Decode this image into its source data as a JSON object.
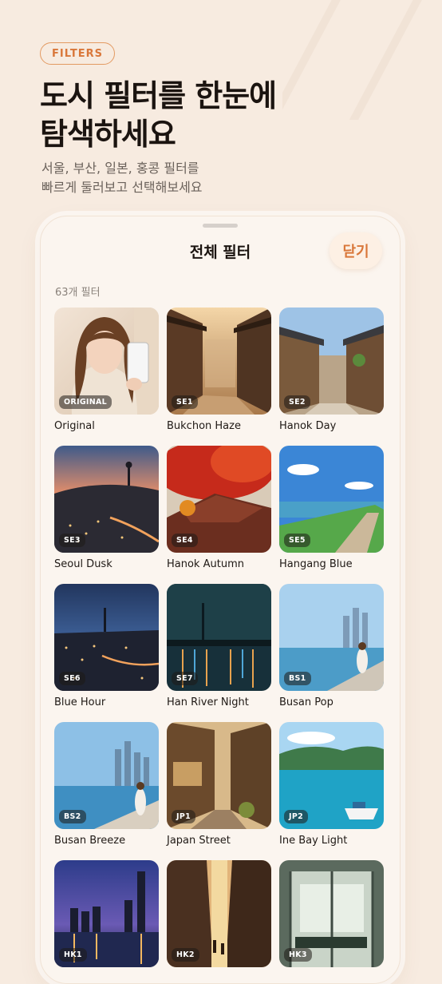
{
  "header": {
    "pill": "FILTERS",
    "headline": [
      "도시 필터를 한눈에",
      "탐색하세요"
    ],
    "subtitle": [
      "서울, 부산, 일본, 홍콩 필터를",
      "빠르게 둘러보고 선택해보세요"
    ]
  },
  "sheet": {
    "title": "전체 필터",
    "close_label": "닫기",
    "count_label": "63개 필터",
    "filters": [
      {
        "code": "ORIGINAL",
        "name": "Original",
        "icon": "portrait-photo"
      },
      {
        "code": "SE1",
        "name": "Bukchon Haze",
        "icon": "hanok-alley-photo"
      },
      {
        "code": "SE2",
        "name": "Hanok Day",
        "icon": "hanok-day-photo"
      },
      {
        "code": "SE3",
        "name": "Seoul Dusk",
        "icon": "seoul-dusk-photo"
      },
      {
        "code": "SE4",
        "name": "Hanok Autumn",
        "icon": "autumn-roof-photo"
      },
      {
        "code": "SE5",
        "name": "Hangang Blue",
        "icon": "river-path-photo"
      },
      {
        "code": "SE6",
        "name": "Blue Hour",
        "icon": "city-night-photo"
      },
      {
        "code": "SE7",
        "name": "Han River Night",
        "icon": "river-night-photo"
      },
      {
        "code": "BS1",
        "name": "Busan Pop",
        "icon": "busan-coast-photo"
      },
      {
        "code": "BS2",
        "name": "Busan Breeze",
        "icon": "busan-breeze-photo"
      },
      {
        "code": "JP1",
        "name": "Japan Street",
        "icon": "japan-street-photo"
      },
      {
        "code": "JP2",
        "name": "Ine Bay Light",
        "icon": "bay-boat-photo"
      },
      {
        "code": "HK1",
        "name": "",
        "icon": "hk-harbor-photo"
      },
      {
        "code": "HK2",
        "name": "",
        "icon": "hk-street-photo"
      },
      {
        "code": "HK3",
        "name": "",
        "icon": "hk-tram-photo"
      }
    ]
  },
  "colors": {
    "background": "#f7ebe0",
    "accent": "#d9773a",
    "sheet": "#fbf5ef"
  }
}
